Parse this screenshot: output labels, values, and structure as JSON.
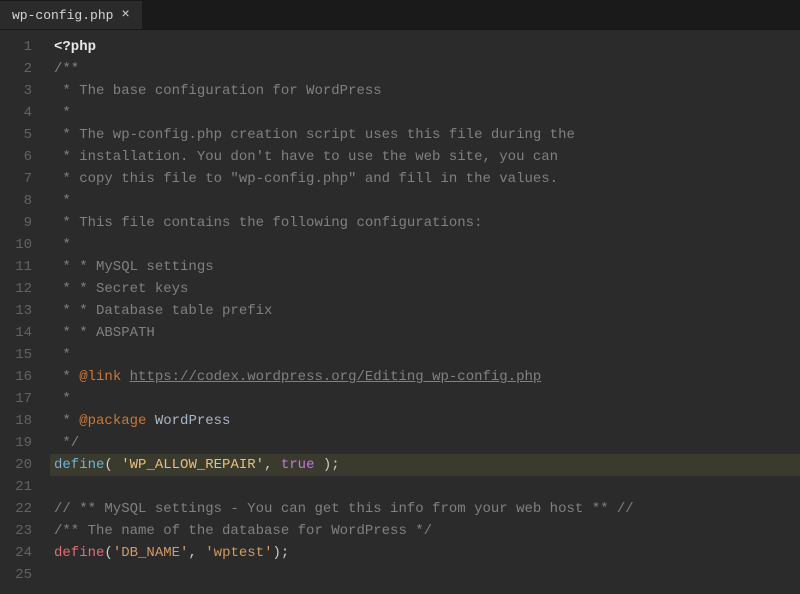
{
  "tab": {
    "filename": "wp-config.php",
    "close": "×"
  },
  "lines": [
    {
      "n": 1,
      "type": "tag",
      "text": "<?php"
    },
    {
      "n": 2,
      "type": "comment",
      "text": "/**"
    },
    {
      "n": 3,
      "type": "comment",
      "text": " * The base configuration for WordPress"
    },
    {
      "n": 4,
      "type": "comment",
      "text": " *"
    },
    {
      "n": 5,
      "type": "comment",
      "text": " * The wp-config.php creation script uses this file during the"
    },
    {
      "n": 6,
      "type": "comment",
      "text": " * installation. You don't have to use the web site, you can"
    },
    {
      "n": 7,
      "type": "comment",
      "text": " * copy this file to \"wp-config.php\" and fill in the values."
    },
    {
      "n": 8,
      "type": "comment",
      "text": " *"
    },
    {
      "n": 9,
      "type": "comment",
      "text": " * This file contains the following configurations:"
    },
    {
      "n": 10,
      "type": "comment",
      "text": " *"
    },
    {
      "n": 11,
      "type": "comment",
      "text": " * * MySQL settings"
    },
    {
      "n": 12,
      "type": "comment",
      "text": " * * Secret keys"
    },
    {
      "n": 13,
      "type": "comment",
      "text": " * * Database table prefix"
    },
    {
      "n": 14,
      "type": "comment",
      "text": " * * ABSPATH"
    },
    {
      "n": 15,
      "type": "comment",
      "text": " *"
    },
    {
      "n": 16,
      "type": "link",
      "prefix": " * ",
      "tag": "@link",
      "url": "https://codex.wordpress.org/Editing_wp-config.php"
    },
    {
      "n": 17,
      "type": "comment",
      "text": " *"
    },
    {
      "n": 18,
      "type": "package",
      "prefix": " * ",
      "tag": "@package",
      "value": "WordPress"
    },
    {
      "n": 19,
      "type": "comment",
      "text": " */"
    },
    {
      "n": 20,
      "type": "define1",
      "selected": true,
      "fn": "define",
      "p1": "( ",
      "s1": "'WP_ALLOW_REPAIR'",
      "c1": ", ",
      "val": "true",
      "p2": " );"
    },
    {
      "n": 21,
      "type": "blank",
      "text": ""
    },
    {
      "n": 22,
      "type": "comment",
      "text": "// ** MySQL settings - You can get this info from your web host ** //"
    },
    {
      "n": 23,
      "type": "comment",
      "text": "/** The name of the database for WordPress */"
    },
    {
      "n": 24,
      "type": "define2",
      "fn": "define",
      "p1": "(",
      "s1": "'DB_NAME'",
      "c1": ", ",
      "s2": "'wptest'",
      "p2": ");"
    },
    {
      "n": 25,
      "type": "blank",
      "text": ""
    }
  ]
}
